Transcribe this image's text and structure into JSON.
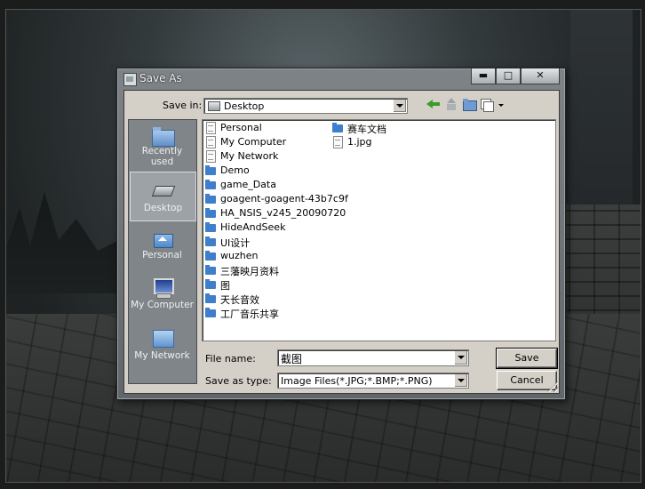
{
  "dialog": {
    "title": "Save As",
    "caption_buttons": {
      "minimize": "▬",
      "maximize": "□",
      "close": "✕"
    }
  },
  "toolbar": {
    "save_in_label": "Save in:",
    "save_in_value": "Desktop",
    "save_in_icon": "desktop-icon",
    "icons": [
      "back-icon",
      "up-folder-icon",
      "new-folder-icon",
      "views-icon"
    ]
  },
  "places": [
    {
      "label": "Recently used",
      "icon": "folder-icon"
    },
    {
      "label": "Desktop",
      "icon": "desktop-icon",
      "selected": true
    },
    {
      "label": "Personal",
      "icon": "home-folder-icon"
    },
    {
      "label": "My Computer",
      "icon": "computer-icon"
    },
    {
      "label": "My Network",
      "icon": "network-icon"
    }
  ],
  "files": {
    "column1": [
      {
        "name": "Personal",
        "icon": "document-icon"
      },
      {
        "name": "My Computer",
        "icon": "document-icon"
      },
      {
        "name": "My Network",
        "icon": "document-icon"
      },
      {
        "name": "Demo",
        "icon": "folder-icon"
      },
      {
        "name": "game_Data",
        "icon": "folder-icon"
      },
      {
        "name": "goagent-goagent-43b7c9f",
        "icon": "folder-icon"
      },
      {
        "name": "HA_NSIS_v245_20090720",
        "icon": "folder-icon"
      },
      {
        "name": "HideAndSeek",
        "icon": "folder-icon"
      },
      {
        "name": "UI设计",
        "icon": "folder-icon"
      },
      {
        "name": "wuzhen",
        "icon": "folder-icon"
      },
      {
        "name": "三藩映月资料",
        "icon": "folder-icon"
      },
      {
        "name": "图",
        "icon": "folder-icon"
      },
      {
        "name": "天长音效",
        "icon": "folder-icon"
      },
      {
        "name": "工厂音乐共享",
        "icon": "folder-icon"
      }
    ],
    "column2": [
      {
        "name": "赛车文档",
        "icon": "folder-icon"
      },
      {
        "name": "1.jpg",
        "icon": "document-icon"
      }
    ]
  },
  "form": {
    "file_name_label": "File name:",
    "file_name_value": "截图",
    "save_type_label": "Save as type:",
    "save_type_value": "Image Files(*.JPG;*.BMP;*.PNG)"
  },
  "buttons": {
    "save": "Save",
    "cancel": "Cancel"
  }
}
